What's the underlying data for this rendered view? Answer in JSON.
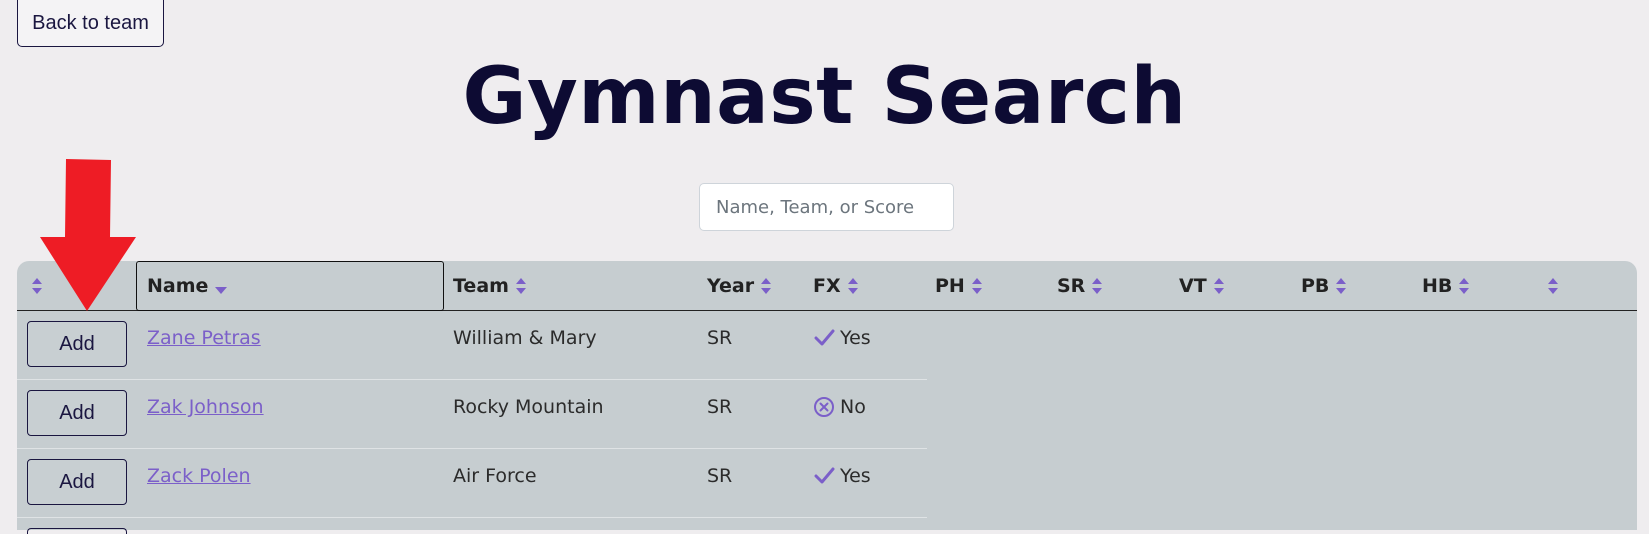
{
  "nav": {
    "back_label": "Back to team"
  },
  "page": {
    "title": "Gymnast Search"
  },
  "search": {
    "placeholder": "Name, Team, or Score",
    "value": ""
  },
  "table": {
    "columns": {
      "name": "Name",
      "team": "Team",
      "year": "Year",
      "fx": "FX",
      "ph": "PH",
      "sr": "SR",
      "vt": "VT",
      "pb": "PB",
      "hb": "HB"
    },
    "rows": [
      {
        "action": "Add",
        "name": "Zane Petras",
        "team": "William & Mary",
        "year": "SR",
        "fx": "Yes",
        "fx_icon": "check-icon"
      },
      {
        "action": "Add",
        "name": "Zak Johnson",
        "team": "Rocky Mountain",
        "year": "SR",
        "fx": "No",
        "fx_icon": "x-circle-icon"
      },
      {
        "action": "Add",
        "name": "Zack Polen",
        "team": "Air Force",
        "year": "SR",
        "fx": "Yes",
        "fx_icon": "check-icon"
      }
    ]
  },
  "colors": {
    "accent": "#7b5fc9",
    "title": "#0d0b33",
    "arrow": "#ee1c25",
    "table_bg": "#c6cdd0",
    "page_bg": "#efedef"
  }
}
